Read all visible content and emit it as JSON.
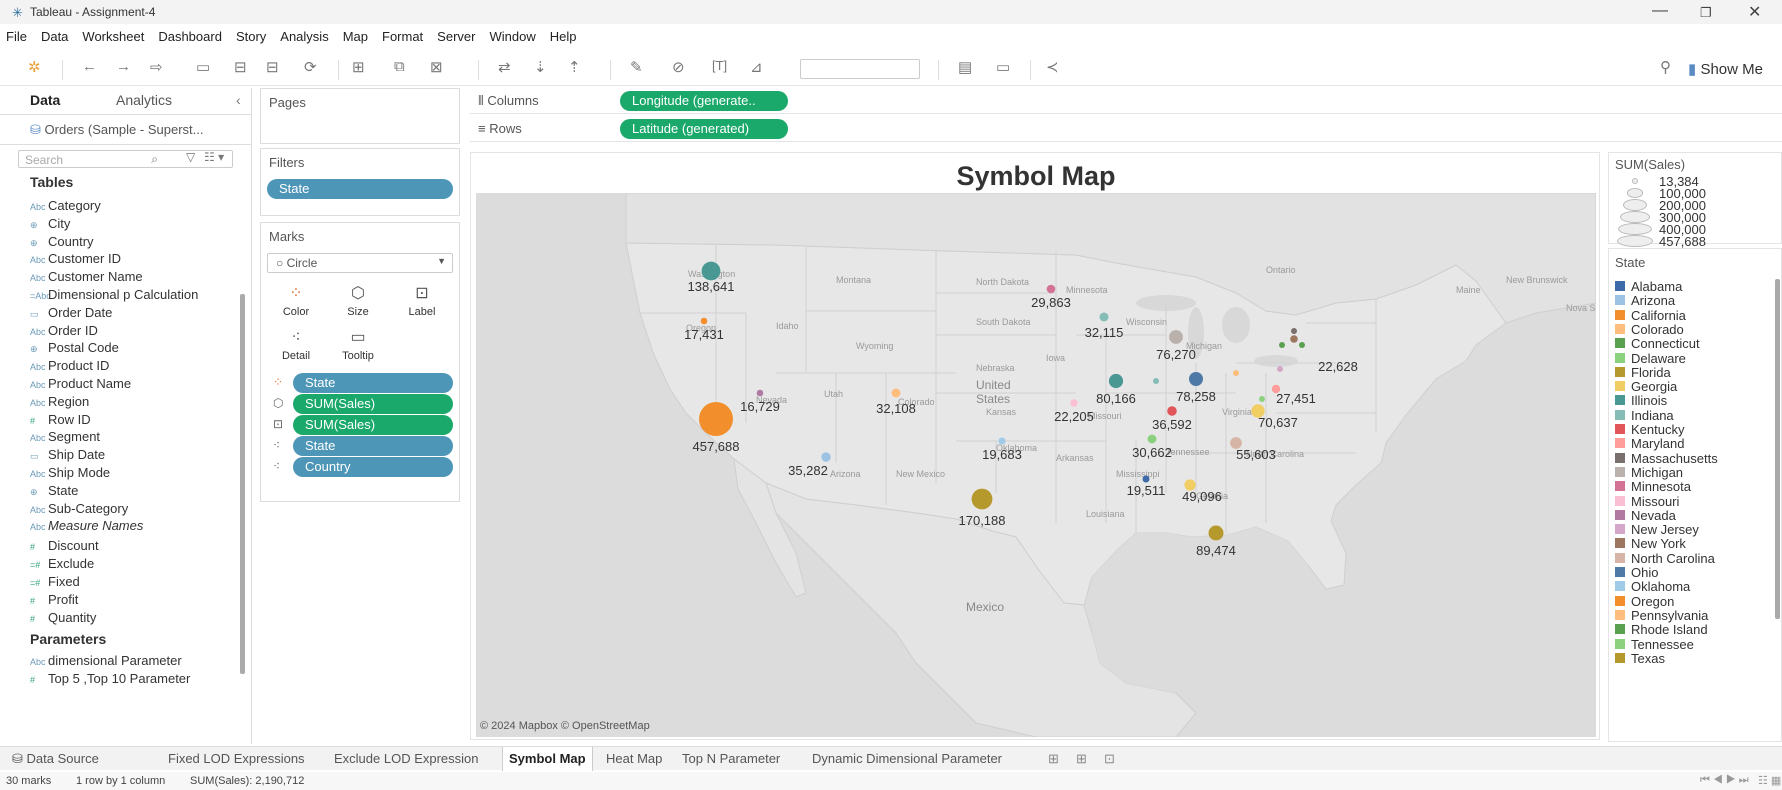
{
  "window": {
    "title": "Tableau - Assignment-4"
  },
  "menu": [
    "File",
    "Data",
    "Worksheet",
    "Dashboard",
    "Story",
    "Analysis",
    "Map",
    "Format",
    "Server",
    "Window",
    "Help"
  ],
  "toolbar": {
    "show_me": "Show Me"
  },
  "data_pane": {
    "tab_data": "Data",
    "tab_analytics": "Analytics",
    "datasource": "Orders (Sample - Superst...",
    "search_placeholder": "Search",
    "tables_header": "Tables",
    "fields": [
      {
        "label": "Category",
        "type": "Abc"
      },
      {
        "label": "City",
        "type": "⊕"
      },
      {
        "label": "Country",
        "type": "⊕"
      },
      {
        "label": "Customer ID",
        "type": "Abc"
      },
      {
        "label": "Customer Name",
        "type": "Abc"
      },
      {
        "label": "Dimensional p Calculation",
        "type": "=Abc"
      },
      {
        "label": "Order Date",
        "type": "▭"
      },
      {
        "label": "Order ID",
        "type": "Abc"
      },
      {
        "label": "Postal Code",
        "type": "⊕"
      },
      {
        "label": "Product ID",
        "type": "Abc"
      },
      {
        "label": "Product Name",
        "type": "Abc"
      },
      {
        "label": "Region",
        "type": "Abc"
      },
      {
        "label": "Row ID",
        "type": "#"
      },
      {
        "label": "Segment",
        "type": "Abc"
      },
      {
        "label": "Ship Date",
        "type": "▭"
      },
      {
        "label": "Ship Mode",
        "type": "Abc"
      },
      {
        "label": "State",
        "type": "⊕"
      },
      {
        "label": "Sub-Category",
        "type": "Abc"
      },
      {
        "label": "Measure Names",
        "type": "Abc"
      },
      {
        "label": "Discount",
        "type": "#"
      },
      {
        "label": "Exclude",
        "type": "=#"
      },
      {
        "label": "Fixed",
        "type": "=#"
      },
      {
        "label": "Profit",
        "type": "#"
      },
      {
        "label": "Quantity",
        "type": "#"
      }
    ],
    "parameters_header": "Parameters",
    "parameters": [
      {
        "label": "dimensional Parameter",
        "type": "Abc"
      },
      {
        "label": "Top 5 ,Top 10 Parameter",
        "type": "#"
      }
    ]
  },
  "pages": {
    "label": "Pages"
  },
  "filters": {
    "label": "Filters",
    "pills": [
      "State"
    ]
  },
  "marks": {
    "label": "Marks",
    "mark_type": "Circle",
    "buttons": [
      "Color",
      "Size",
      "Label",
      "Detail",
      "Tooltip"
    ],
    "pills": [
      "State",
      "SUM(Sales)",
      "SUM(Sales)",
      "State",
      "Country"
    ]
  },
  "shelves": {
    "columns_label": "Columns",
    "columns_pill": "Longitude (generate..",
    "rows_label": "Rows",
    "rows_pill": "Latitude (generated)"
  },
  "viz": {
    "title": "Symbol Map",
    "attribution": "© 2024 Mapbox © OpenStreetMap",
    "map_labels": [
      "Ontario",
      "Montana",
      "North Dakota",
      "Minnesota",
      "Wisconsin",
      "Michigan",
      "South Dakota",
      "Wyoming",
      "Idaho",
      "Oregon",
      "Washington",
      "Nevada",
      "Utah",
      "Colorado",
      "Nebraska",
      "Iowa",
      "United",
      "States",
      "Kansas",
      "Missouri",
      "Arizona",
      "New Mexico",
      "Oklahoma",
      "Arkansas",
      "Mississippi",
      "Louisiana",
      "Tennessee",
      "North Carolina",
      "Virginia",
      "Georgia",
      "Mexico",
      "New Brunswick",
      "Maine",
      "Nova Scot"
    ],
    "symbols": [
      {
        "state": "Washington",
        "value": "138,641"
      },
      {
        "state": "Oregon",
        "value": "17,431"
      },
      {
        "state": "California",
        "value": "457,688"
      },
      {
        "state": "Nevada",
        "value": "16,729"
      },
      {
        "state": "Arizona",
        "value": "35,282"
      },
      {
        "state": "Colorado",
        "value": "32,108"
      },
      {
        "state": "Texas",
        "value": "170,188"
      },
      {
        "state": "Oklahoma",
        "value": "19,683"
      },
      {
        "state": "Minnesota",
        "value": "29,863"
      },
      {
        "state": "Wisconsin",
        "value": "32,115"
      },
      {
        "state": "Michigan",
        "value": "76,270"
      },
      {
        "state": "Illinois",
        "value": "80,166"
      },
      {
        "state": "Ohio",
        "value": "78,258"
      },
      {
        "state": "Missouri",
        "value": "22,205"
      },
      {
        "state": "Kentucky",
        "value": "36,592"
      },
      {
        "state": "Tennessee",
        "value": "30,662"
      },
      {
        "state": "Alabama",
        "value": "19,511"
      },
      {
        "state": "Georgia",
        "value": "49,096"
      },
      {
        "state": "Florida",
        "value": "89,474"
      },
      {
        "state": "North Carolina",
        "value": "55,603"
      },
      {
        "state": "Virginia",
        "value": "70,637"
      },
      {
        "state": "Maryland",
        "value": "27,451"
      },
      {
        "state": "New York",
        "value": "22,628"
      }
    ]
  },
  "size_legend": {
    "title": "SUM(Sales)",
    "items": [
      "13,384",
      "100,000",
      "200,000",
      "300,000",
      "400,000",
      "457,688"
    ]
  },
  "color_legend": {
    "title": "State",
    "items": [
      {
        "label": "Alabama",
        "color": "#3d6aa8"
      },
      {
        "label": "Arizona",
        "color": "#9cc3e4"
      },
      {
        "label": "California",
        "color": "#f28e2b"
      },
      {
        "label": "Colorado",
        "color": "#ffbe7d"
      },
      {
        "label": "Connecticut",
        "color": "#59a14f"
      },
      {
        "label": "Delaware",
        "color": "#8cd17d"
      },
      {
        "label": "Florida",
        "color": "#b6992d"
      },
      {
        "label": "Georgia",
        "color": "#f1ce63"
      },
      {
        "label": "Illinois",
        "color": "#499894"
      },
      {
        "label": "Indiana",
        "color": "#86bcb6"
      },
      {
        "label": "Kentucky",
        "color": "#e15759"
      },
      {
        "label": "Maryland",
        "color": "#ff9d9a"
      },
      {
        "label": "Massachusetts",
        "color": "#79706e"
      },
      {
        "label": "Michigan",
        "color": "#bab0ac"
      },
      {
        "label": "Minnesota",
        "color": "#d37295"
      },
      {
        "label": "Missouri",
        "color": "#fabfd2"
      },
      {
        "label": "Nevada",
        "color": "#b07aa1"
      },
      {
        "label": "New Jersey",
        "color": "#d4a6c8"
      },
      {
        "label": "New York",
        "color": "#9d7660"
      },
      {
        "label": "North Carolina",
        "color": "#d7b5a6"
      },
      {
        "label": "Ohio",
        "color": "#4e79a7"
      },
      {
        "label": "Oklahoma",
        "color": "#a0cbe8"
      },
      {
        "label": "Oregon",
        "color": "#f28e2b"
      },
      {
        "label": "Pennsylvania",
        "color": "#ffbe7d"
      },
      {
        "label": "Rhode Island",
        "color": "#59a14f"
      },
      {
        "label": "Tennessee",
        "color": "#8cd17d"
      },
      {
        "label": "Texas",
        "color": "#b6992d"
      }
    ]
  },
  "sheet_tabs": {
    "data_source": "Data Source",
    "tabs": [
      "Fixed LOD Expressions",
      "Exclude LOD Expression",
      "Symbol Map",
      "Heat Map",
      "Top N Parameter",
      "Dynamic Dimensional Parameter"
    ],
    "active": "Symbol Map"
  },
  "status": {
    "marks": "30 marks",
    "layout": "1 row by 1 column",
    "sum": "SUM(Sales): 2,190,712"
  }
}
